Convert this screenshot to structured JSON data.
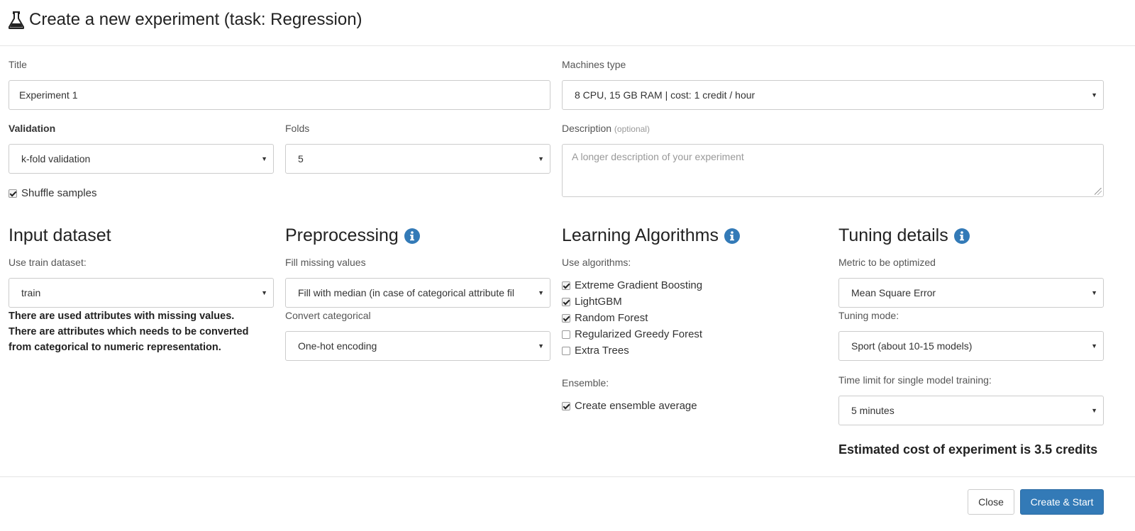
{
  "modal": {
    "title": "Create a new experiment (task: Regression)",
    "icon": "flask-icon"
  },
  "form": {
    "title_label": "Title",
    "title_value": "Experiment 1",
    "machines_label": "Machines type",
    "machines_value": "8 CPU, 15 GB RAM | cost: 1 credit / hour",
    "validation_label": "Validation",
    "validation_value": "k-fold validation",
    "folds_label": "Folds",
    "folds_value": "5",
    "description_label": "Description",
    "description_optional": "(optional)",
    "description_placeholder": "A longer description of your experiment",
    "shuffle_label": "Shuffle samples",
    "shuffle_checked": true
  },
  "input_dataset": {
    "heading": "Input dataset",
    "train_label": "Use train dataset:",
    "train_value": "train",
    "warnings": [
      "There are used attributes with missing values.",
      "There are attributes which needs to be converted",
      "from categorical to numeric representation."
    ]
  },
  "preprocessing": {
    "heading": "Preprocessing",
    "fill_label": "Fill missing values",
    "fill_value": "Fill with median (in case of categorical attribute fil",
    "convert_label": "Convert categorical",
    "convert_value": "One-hot encoding"
  },
  "algorithms": {
    "heading": "Learning Algorithms",
    "use_label": "Use algorithms:",
    "items": [
      {
        "label": "Extreme Gradient Boosting",
        "checked": true
      },
      {
        "label": "LightGBM",
        "checked": true
      },
      {
        "label": "Random Forest",
        "checked": true
      },
      {
        "label": "Regularized Greedy Forest",
        "checked": false
      },
      {
        "label": "Extra Trees",
        "checked": false
      }
    ],
    "ensemble_label": "Ensemble:",
    "ensemble_item": {
      "label": "Create ensemble average",
      "checked": true
    }
  },
  "tuning": {
    "heading": "Tuning details",
    "metric_label": "Metric to be optimized",
    "metric_value": "Mean Square Error",
    "mode_label": "Tuning mode:",
    "mode_value": "Sport (about 10-15 models)",
    "time_label": "Time limit for single model training:",
    "time_value": "5 minutes",
    "estimate": "Estimated cost of experiment is 3.5 credits"
  },
  "footer": {
    "close_label": "Close",
    "create_label": "Create & Start"
  },
  "colors": {
    "primary": "#337ab7",
    "info_icon": "#337ab7"
  }
}
